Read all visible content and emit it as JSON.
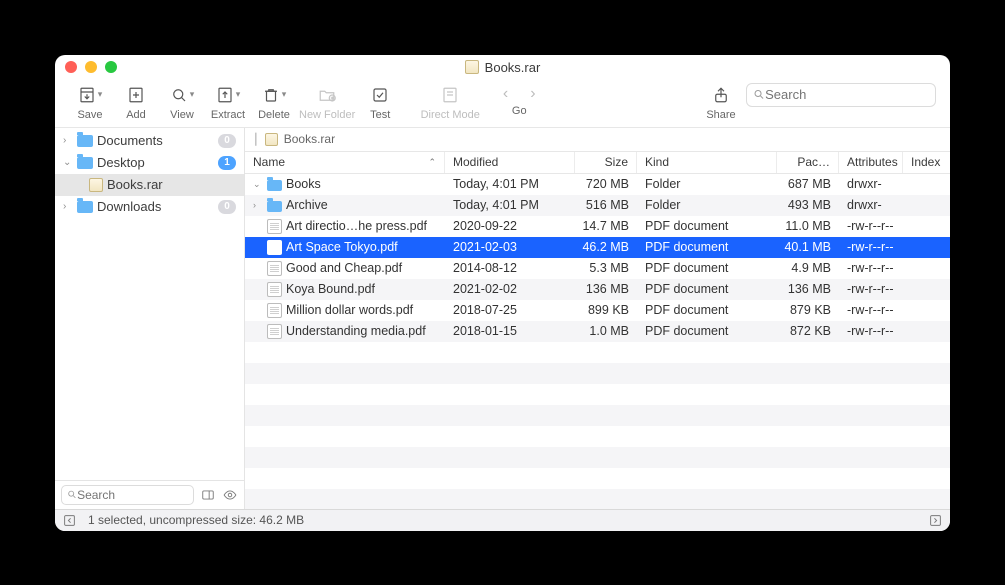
{
  "window": {
    "title": "Books.rar"
  },
  "toolbar": {
    "save": "Save",
    "add": "Add",
    "view": "View",
    "extract": "Extract",
    "delete": "Delete",
    "new_folder": "New Folder",
    "test": "Test",
    "direct_mode": "Direct Mode",
    "go": "Go",
    "share": "Share",
    "search_placeholder": "Search"
  },
  "sidebar": {
    "items": [
      {
        "label": "Documents",
        "badge": "0",
        "type": "folder",
        "expand": ">"
      },
      {
        "label": "Desktop",
        "badge": "1",
        "type": "folder",
        "expand": "v",
        "active_badge": true
      },
      {
        "label": "Books.rar",
        "type": "archive",
        "child": true
      },
      {
        "label": "Downloads",
        "badge": "0",
        "type": "folder",
        "expand": ">"
      }
    ],
    "search_placeholder": "Search"
  },
  "path": {
    "crumb": "Books.rar"
  },
  "columns": {
    "name": "Name",
    "modified": "Modified",
    "size": "Size",
    "kind": "Kind",
    "packed": "Pac…",
    "attributes": "Attributes",
    "index": "Index"
  },
  "rows": [
    {
      "indent": 0,
      "disc": "v",
      "icon": "folder",
      "name": "Books",
      "modified": "Today, 4:01 PM",
      "size": "720 MB",
      "kind": "Folder",
      "packed": "687 MB",
      "attr": "drwxr-"
    },
    {
      "indent": 1,
      "disc": ">",
      "icon": "folder",
      "name": "Archive",
      "modified": "Today, 4:01 PM",
      "size": "516 MB",
      "kind": "Folder",
      "packed": "493 MB",
      "attr": "drwxr-"
    },
    {
      "indent": 2,
      "icon": "doc",
      "name": "Art directio…he press.pdf",
      "modified": "2020-09-22",
      "size": "14.7 MB",
      "kind": "PDF document",
      "packed": "11.0 MB",
      "attr": "-rw-r--r--"
    },
    {
      "indent": 2,
      "icon": "pdf",
      "name": "Art Space Tokyo.pdf",
      "modified": "2021-02-03",
      "size": "46.2 MB",
      "kind": "PDF document",
      "packed": "40.1 MB",
      "attr": "-rw-r--r--",
      "selected": true
    },
    {
      "indent": 2,
      "icon": "doc",
      "name": "Good and Cheap.pdf",
      "modified": "2014-08-12",
      "size": "5.3 MB",
      "kind": "PDF document",
      "packed": "4.9 MB",
      "attr": "-rw-r--r--"
    },
    {
      "indent": 2,
      "icon": "doc",
      "name": "Koya Bound.pdf",
      "modified": "2021-02-02",
      "size": "136 MB",
      "kind": "PDF document",
      "packed": "136 MB",
      "attr": "-rw-r--r--"
    },
    {
      "indent": 2,
      "icon": "doc",
      "name": "Million dollar words.pdf",
      "modified": "2018-07-25",
      "size": "899 KB",
      "kind": "PDF document",
      "packed": "879 KB",
      "attr": "-rw-r--r--"
    },
    {
      "indent": 2,
      "icon": "doc",
      "name": "Understanding media.pdf",
      "modified": "2018-01-15",
      "size": "1.0 MB",
      "kind": "PDF document",
      "packed": "872 KB",
      "attr": "-rw-r--r--"
    }
  ],
  "status": {
    "text": "1 selected, uncompressed size: 46.2 MB"
  }
}
